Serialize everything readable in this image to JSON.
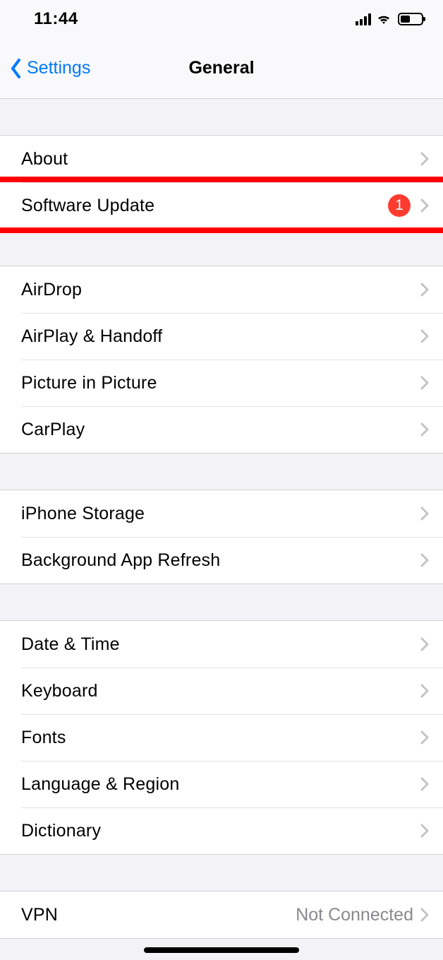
{
  "status": {
    "time": "11:44"
  },
  "nav": {
    "back_label": "Settings",
    "title": "General"
  },
  "groups": [
    {
      "rows": [
        {
          "label": "About",
          "badge": null,
          "value": null,
          "highlight": false
        },
        {
          "label": "Software Update",
          "badge": "1",
          "value": null,
          "highlight": true
        }
      ]
    },
    {
      "rows": [
        {
          "label": "AirDrop",
          "badge": null,
          "value": null,
          "highlight": false
        },
        {
          "label": "AirPlay & Handoff",
          "badge": null,
          "value": null,
          "highlight": false
        },
        {
          "label": "Picture in Picture",
          "badge": null,
          "value": null,
          "highlight": false
        },
        {
          "label": "CarPlay",
          "badge": null,
          "value": null,
          "highlight": false
        }
      ]
    },
    {
      "rows": [
        {
          "label": "iPhone Storage",
          "badge": null,
          "value": null,
          "highlight": false
        },
        {
          "label": "Background App Refresh",
          "badge": null,
          "value": null,
          "highlight": false
        }
      ]
    },
    {
      "rows": [
        {
          "label": "Date & Time",
          "badge": null,
          "value": null,
          "highlight": false
        },
        {
          "label": "Keyboard",
          "badge": null,
          "value": null,
          "highlight": false
        },
        {
          "label": "Fonts",
          "badge": null,
          "value": null,
          "highlight": false
        },
        {
          "label": "Language & Region",
          "badge": null,
          "value": null,
          "highlight": false
        },
        {
          "label": "Dictionary",
          "badge": null,
          "value": null,
          "highlight": false
        }
      ]
    },
    {
      "rows": [
        {
          "label": "VPN",
          "badge": null,
          "value": "Not Connected",
          "highlight": false
        }
      ]
    }
  ]
}
